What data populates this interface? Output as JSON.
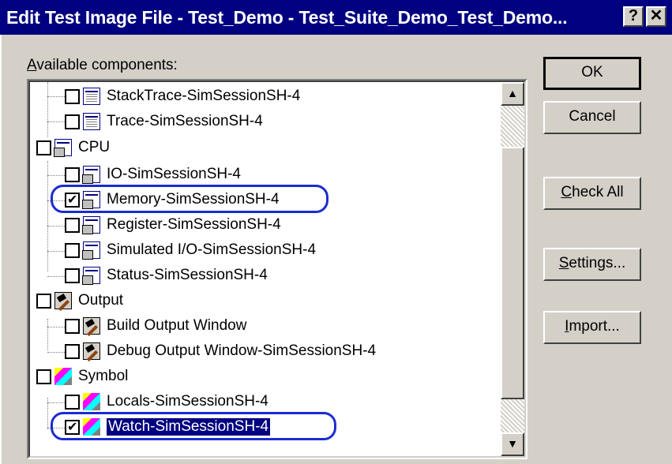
{
  "window": {
    "title": "Edit Test Image File - Test_Demo - Test_Suite_Demo_Test_Demo...",
    "help_button": "?",
    "close_button": "✕"
  },
  "components": {
    "label_mnemonic": "A",
    "label_rest": "vailable components:",
    "items": [
      {
        "label": "StackTrace-SimSessionSH-4",
        "checked": false,
        "icon": "window-icon",
        "level": 1
      },
      {
        "label": "Trace-SimSessionSH-4",
        "checked": false,
        "icon": "window-icon",
        "level": 1
      },
      {
        "label": "CPU",
        "checked": false,
        "icon": "cpu-icon",
        "level": 0
      },
      {
        "label": "IO-SimSessionSH-4",
        "checked": false,
        "icon": "cpu-icon",
        "level": 1
      },
      {
        "label": "Memory-SimSessionSH-4",
        "checked": true,
        "icon": "cpu-icon",
        "level": 1
      },
      {
        "label": "Register-SimSessionSH-4",
        "checked": false,
        "icon": "cpu-icon",
        "level": 1
      },
      {
        "label": "Simulated I/O-SimSessionSH-4",
        "checked": false,
        "icon": "cpu-icon",
        "level": 1
      },
      {
        "label": "Status-SimSessionSH-4",
        "checked": false,
        "icon": "cpu-icon",
        "level": 1
      },
      {
        "label": "Output",
        "checked": false,
        "icon": "output-icon",
        "level": 0
      },
      {
        "label": "Build Output Window",
        "checked": false,
        "icon": "output-icon",
        "level": 1
      },
      {
        "label": "Debug Output Window-SimSessionSH-4",
        "checked": false,
        "icon": "output-icon",
        "level": 1
      },
      {
        "label": "Symbol",
        "checked": false,
        "icon": "symbol-icon",
        "level": 0
      },
      {
        "label": "Locals-SimSessionSH-4",
        "checked": false,
        "icon": "symbol-icon",
        "level": 1
      },
      {
        "label": "Watch-SimSessionSH-4",
        "checked": true,
        "icon": "symbol-icon",
        "level": 1,
        "selected": true
      }
    ]
  },
  "buttons": {
    "ok": "OK",
    "cancel": "Cancel",
    "check_all_mnemonic": "C",
    "check_all_rest": "heck All",
    "settings_mnemonic": "S",
    "settings_rest": "ettings...",
    "import_mnemonic": "I",
    "import_rest": "mport..."
  },
  "scrollbar": {
    "up_arrow": "▲",
    "down_arrow": "▼"
  },
  "colors": {
    "titlebar": "#000080",
    "face": "#d4d0c8",
    "highlight_oval": "#1c2bd0",
    "selection": "#000080"
  }
}
